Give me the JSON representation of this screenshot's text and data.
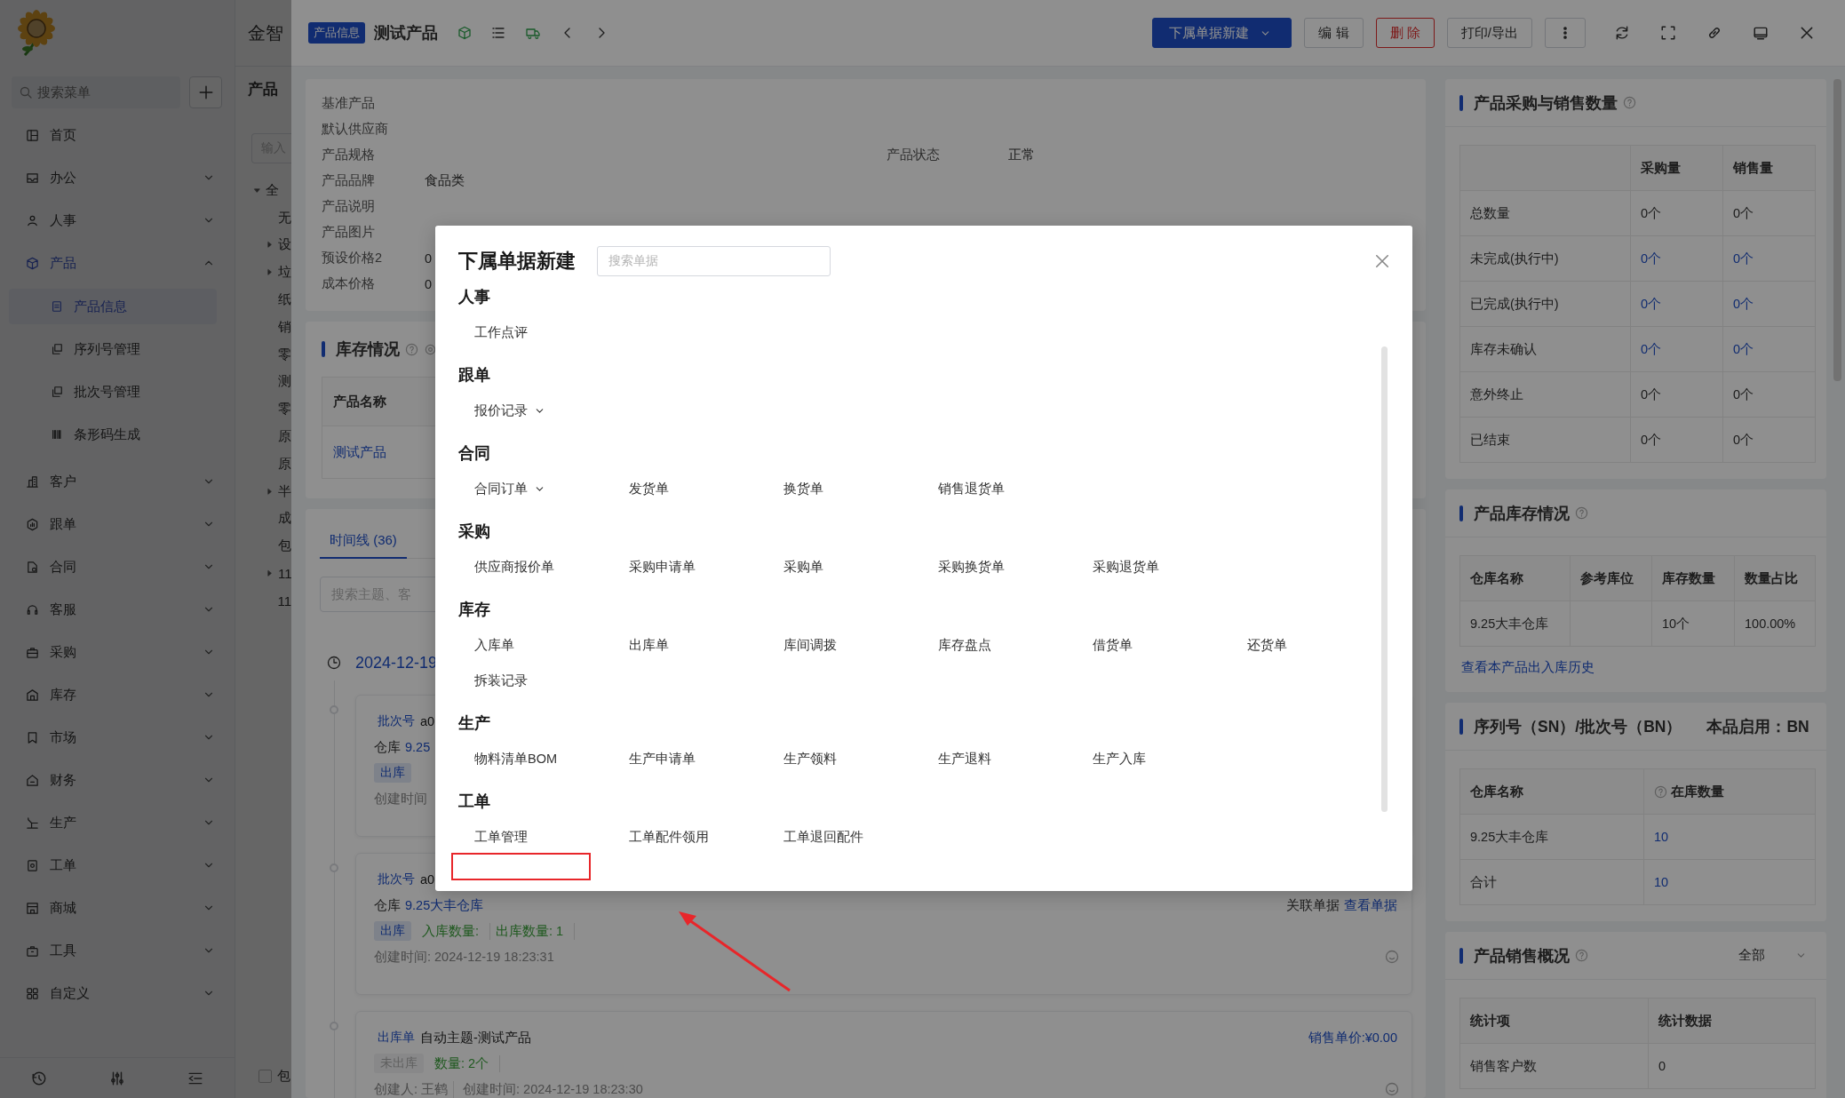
{
  "app": {
    "brand": "金智"
  },
  "sidebar": {
    "search": {
      "placeholder": "搜索菜单"
    },
    "items": [
      {
        "label": "首页",
        "kind": "link",
        "selected": false
      },
      {
        "label": "办公",
        "kind": "group",
        "selected": false,
        "expanded": false
      },
      {
        "label": "人事",
        "kind": "group",
        "selected": false,
        "expanded": false
      },
      {
        "label": "产品",
        "kind": "group",
        "selected": true,
        "expanded": true,
        "children": [
          {
            "label": "产品信息",
            "selected": true
          },
          {
            "label": "序列号管理",
            "selected": false
          },
          {
            "label": "批次号管理",
            "selected": false
          },
          {
            "label": "条形码生成",
            "selected": false
          }
        ]
      },
      {
        "label": "客户",
        "kind": "group",
        "selected": false,
        "expanded": false
      },
      {
        "label": "跟单",
        "kind": "group",
        "selected": false,
        "expanded": false
      },
      {
        "label": "合同",
        "kind": "group",
        "selected": false,
        "expanded": false
      },
      {
        "label": "客服",
        "kind": "group",
        "selected": false,
        "expanded": false
      },
      {
        "label": "采购",
        "kind": "group",
        "selected": false,
        "expanded": false
      },
      {
        "label": "库存",
        "kind": "group",
        "selected": false,
        "expanded": false
      },
      {
        "label": "市场",
        "kind": "group",
        "selected": false,
        "expanded": false
      },
      {
        "label": "财务",
        "kind": "group",
        "selected": false,
        "expanded": false
      },
      {
        "label": "生产",
        "kind": "group",
        "selected": false,
        "expanded": false
      },
      {
        "label": "工单",
        "kind": "group",
        "selected": false,
        "expanded": false
      },
      {
        "label": "商城",
        "kind": "group",
        "selected": false,
        "expanded": false
      },
      {
        "label": "工具",
        "kind": "group",
        "selected": false,
        "expanded": false
      },
      {
        "label": "自定义",
        "kind": "group",
        "selected": false,
        "expanded": false
      }
    ]
  },
  "tree_panel": {
    "title": "产品",
    "filter": {
      "placeholder": "输入"
    },
    "nodes": [
      {
        "label": "全",
        "kind": "branch",
        "expanded": true,
        "children": [
          {
            "label": "无",
            "kind": "leaf"
          },
          {
            "label": "设",
            "kind": "branch",
            "expanded": false
          },
          {
            "label": "垃",
            "kind": "branch",
            "expanded": false
          },
          {
            "label": "纸",
            "kind": "leaf"
          },
          {
            "label": "销",
            "kind": "leaf"
          },
          {
            "label": "零",
            "kind": "leaf"
          },
          {
            "label": "测",
            "kind": "leaf"
          },
          {
            "label": "零",
            "kind": "leaf"
          },
          {
            "label": "原",
            "kind": "leaf"
          },
          {
            "label": "原",
            "kind": "leaf"
          },
          {
            "label": "半",
            "kind": "branch",
            "expanded": false
          },
          {
            "label": "成",
            "kind": "leaf"
          },
          {
            "label": "包",
            "kind": "leaf"
          },
          {
            "label": "11",
            "kind": "branch",
            "expanded": false
          },
          {
            "label": "11",
            "kind": "leaf"
          }
        ]
      }
    ],
    "footer_checkbox": {
      "label": "包",
      "checked": false
    }
  },
  "drawer": {
    "tag": "产品信息",
    "title": "测试产品",
    "buttons": [
      {
        "label": "下属单据新建",
        "kind": "primary",
        "menu": true
      },
      {
        "label": "编 辑",
        "kind": "default",
        "menu": false
      },
      {
        "label": "删 除",
        "kind": "danger",
        "menu": false
      },
      {
        "label": "打印/导出",
        "kind": "default",
        "menu": false
      }
    ]
  },
  "details": [
    {
      "label": "基准产品"
    },
    {
      "label": "默认供应商"
    },
    {
      "label": "产品规格",
      "extra": {
        "label": "产品状态",
        "value": "正常"
      }
    },
    {
      "label": "产品品牌",
      "value": "食品类"
    },
    {
      "label": "产品说明"
    },
    {
      "label": "产品图片"
    },
    {
      "label": "预设价格2",
      "value": "0"
    },
    {
      "label": "成本价格",
      "value": "0"
    }
  ],
  "stock": {
    "title": "库存情况",
    "column": "产品名称",
    "row": "测试产品"
  },
  "timeline": {
    "tabs": [
      {
        "label": "时间线 (36)",
        "selected": true
      }
    ],
    "search": {
      "placeholder": "搜索主题、客"
    },
    "date": "2024-12-19",
    "entries": [
      {
        "tag": "批次号",
        "title": "a0",
        "warehouse": {
          "label": "仓库",
          "value": "9.25"
        },
        "badge": {
          "label": "出库",
          "kind": "info"
        },
        "meta": [
          "创建时间"
        ]
      },
      {
        "tag": "批次号",
        "title": "a0",
        "related": {
          "label": "关联单据",
          "link": "查看单据"
        },
        "warehouse": {
          "label": "仓库",
          "value": "9.25大丰仓库"
        },
        "badge": {
          "label": "出库",
          "kind": "info"
        },
        "stats": [
          "入库数量:",
          "出库数量: 1"
        ],
        "meta": [
          "创建时间: 2024-12-19 18:23:31"
        ],
        "comment_icon": true
      },
      {
        "tag": "出库单",
        "title": "自动主题-测试产品",
        "price": "销售单价:¥0.00",
        "badge": {
          "label": "未出库",
          "kind": "muted"
        },
        "stats": [
          "数量: 2个"
        ],
        "meta": [
          "创建人: 王鹤",
          "创建时间: 2024-12-19 18:23:30"
        ],
        "comment_icon": true
      }
    ]
  },
  "right_cards": [
    {
      "title": "产品采购与销售数量",
      "help": true,
      "table": {
        "columns": [
          {
            "help": false
          },
          {
            "label": "采购量",
            "help": false
          },
          {
            "label": "销售量",
            "help": false
          }
        ],
        "rows": [
          {
            "cells": [
              "总数量",
              "0个",
              "0个"
            ],
            "link": false
          },
          {
            "cells": [
              "未完成(执行中)",
              "0个",
              "0个"
            ],
            "link": true
          },
          {
            "cells": [
              "已完成(执行中)",
              "0个",
              "0个"
            ],
            "link": true
          },
          {
            "cells": [
              "库存未确认",
              "0个",
              "0个"
            ],
            "link": true
          },
          {
            "cells": [
              "意外终止",
              "0个",
              "0个"
            ],
            "link": false
          },
          {
            "cells": [
              "已结束",
              "0个",
              "0个"
            ],
            "link": false
          }
        ]
      }
    },
    {
      "title": "产品库存情况",
      "help": true,
      "table": {
        "columns": [
          {
            "label": "仓库名称",
            "help": false
          },
          {
            "label": "参考库位",
            "help": false
          },
          {
            "label": "库存数量",
            "help": false
          },
          {
            "label": "数量占比",
            "help": false
          }
        ],
        "rows": [
          {
            "cells": [
              "9.25大丰仓库",
              null,
              "10个",
              "100.00%"
            ],
            "link": false
          }
        ]
      },
      "link": "查看本产品出入库历史"
    },
    {
      "title": "序列号（SN）/批次号（BN）",
      "subtitle": "本品启用：BN",
      "help": false,
      "table": {
        "columns": [
          {
            "label": "仓库名称",
            "help": false
          },
          {
            "label": "在库数量",
            "help": true
          }
        ],
        "rows": [
          {
            "cells": [
              "9.25大丰仓库",
              "10"
            ],
            "link": true
          },
          {
            "cells": [
              "合计",
              "10"
            ],
            "link": true
          }
        ]
      }
    },
    {
      "title": "产品销售概况",
      "help": true,
      "filter": "全部",
      "table": {
        "columns": [
          {
            "label": "统计项",
            "help": false
          },
          {
            "label": "统计数据",
            "help": false
          }
        ],
        "rows": [
          {
            "cells": [
              "销售客户数",
              "0"
            ],
            "link": false
          }
        ]
      }
    }
  ],
  "modal": {
    "title": "下属单据新建",
    "search": {
      "placeholder": "搜索单据"
    },
    "sections": [
      {
        "title": "人事",
        "items": [
          {
            "label": "工作点评",
            "menu": false
          }
        ]
      },
      {
        "title": "跟单",
        "items": [
          {
            "label": "报价记录",
            "menu": true
          }
        ]
      },
      {
        "title": "合同",
        "items": [
          {
            "label": "合同订单",
            "menu": true
          },
          {
            "label": "发货单",
            "menu": false
          },
          {
            "label": "换货单",
            "menu": false
          },
          {
            "label": "销售退货单",
            "menu": false
          }
        ]
      },
      {
        "title": "采购",
        "items": [
          {
            "label": "供应商报价单",
            "menu": false
          },
          {
            "label": "采购申请单",
            "menu": false
          },
          {
            "label": "采购单",
            "menu": false
          },
          {
            "label": "采购换货单",
            "menu": false
          },
          {
            "label": "采购退货单",
            "menu": false
          }
        ]
      },
      {
        "title": "库存",
        "items": [
          {
            "label": "入库单",
            "menu": false
          },
          {
            "label": "出库单",
            "menu": false
          },
          {
            "label": "库间调拨",
            "menu": false
          },
          {
            "label": "库存盘点",
            "menu": false
          },
          {
            "label": "借货单",
            "menu": false
          },
          {
            "label": "还货单",
            "menu": false
          },
          {
            "label": "拆装记录",
            "menu": false
          }
        ]
      },
      {
        "title": "生产",
        "items": [
          {
            "label": "物料清单BOM",
            "menu": false
          },
          {
            "label": "生产申请单",
            "menu": false
          },
          {
            "label": "生产领料",
            "menu": false
          },
          {
            "label": "生产退料",
            "menu": false
          },
          {
            "label": "生产入库",
            "menu": false
          }
        ]
      },
      {
        "title": "工单",
        "items": [
          {
            "label": "工单管理",
            "menu": false
          },
          {
            "label": "工单配件领用",
            "menu": false
          },
          {
            "label": "工单退回配件",
            "menu": false
          }
        ]
      }
    ]
  },
  "markup": {
    "highlight_box": true,
    "arrow": true
  }
}
